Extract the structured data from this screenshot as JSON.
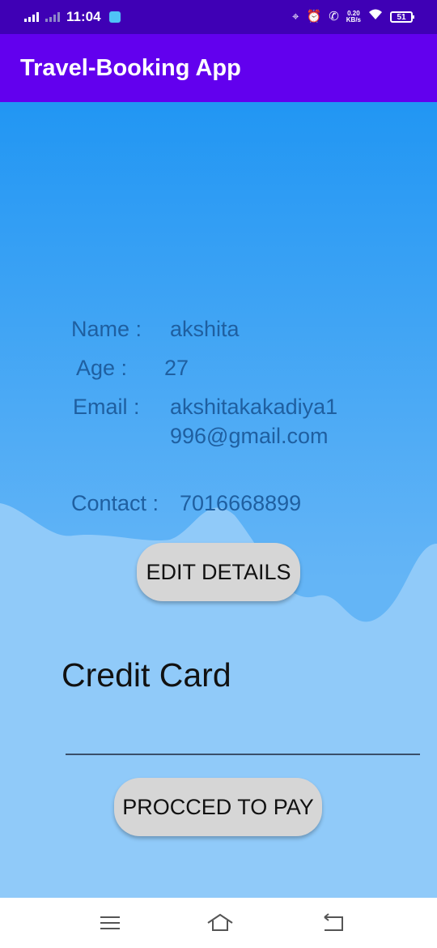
{
  "status_bar": {
    "time": "11:04",
    "net_speed_value": "0.20",
    "net_speed_unit": "KB/s",
    "battery": "51",
    "icons": [
      "signal-icon",
      "signal-weak-icon",
      "app-notification-icon",
      "location-icon",
      "alarm-icon",
      "wifi-call-icon",
      "wifi-icon",
      "battery-icon"
    ]
  },
  "app_bar": {
    "title": "Travel-Booking App"
  },
  "profile": {
    "name_label": "Name :",
    "name_value": "akshita",
    "age_label": "Age :",
    "age_value": "27",
    "email_label": "Email :",
    "email_value": "akshitakakadiya1996@gmail.com",
    "contact_label": "Contact :",
    "contact_value": "7016668899"
  },
  "buttons": {
    "edit_details": "EDIT DETAILS",
    "proceed_to_pay": "PROCCED TO PAY"
  },
  "payment": {
    "credit_card_label": "Credit Card",
    "credit_card_value": ""
  },
  "nav_bar": {
    "icons": [
      "menu-icon",
      "home-icon",
      "back-icon"
    ]
  },
  "colors": {
    "status_bar": "#3f00b5",
    "app_bar": "#6200ee",
    "content_top": "#2196f3",
    "wave": "#90caf9",
    "field_text": "#1f5fa0",
    "button": "#d6d6d6"
  }
}
